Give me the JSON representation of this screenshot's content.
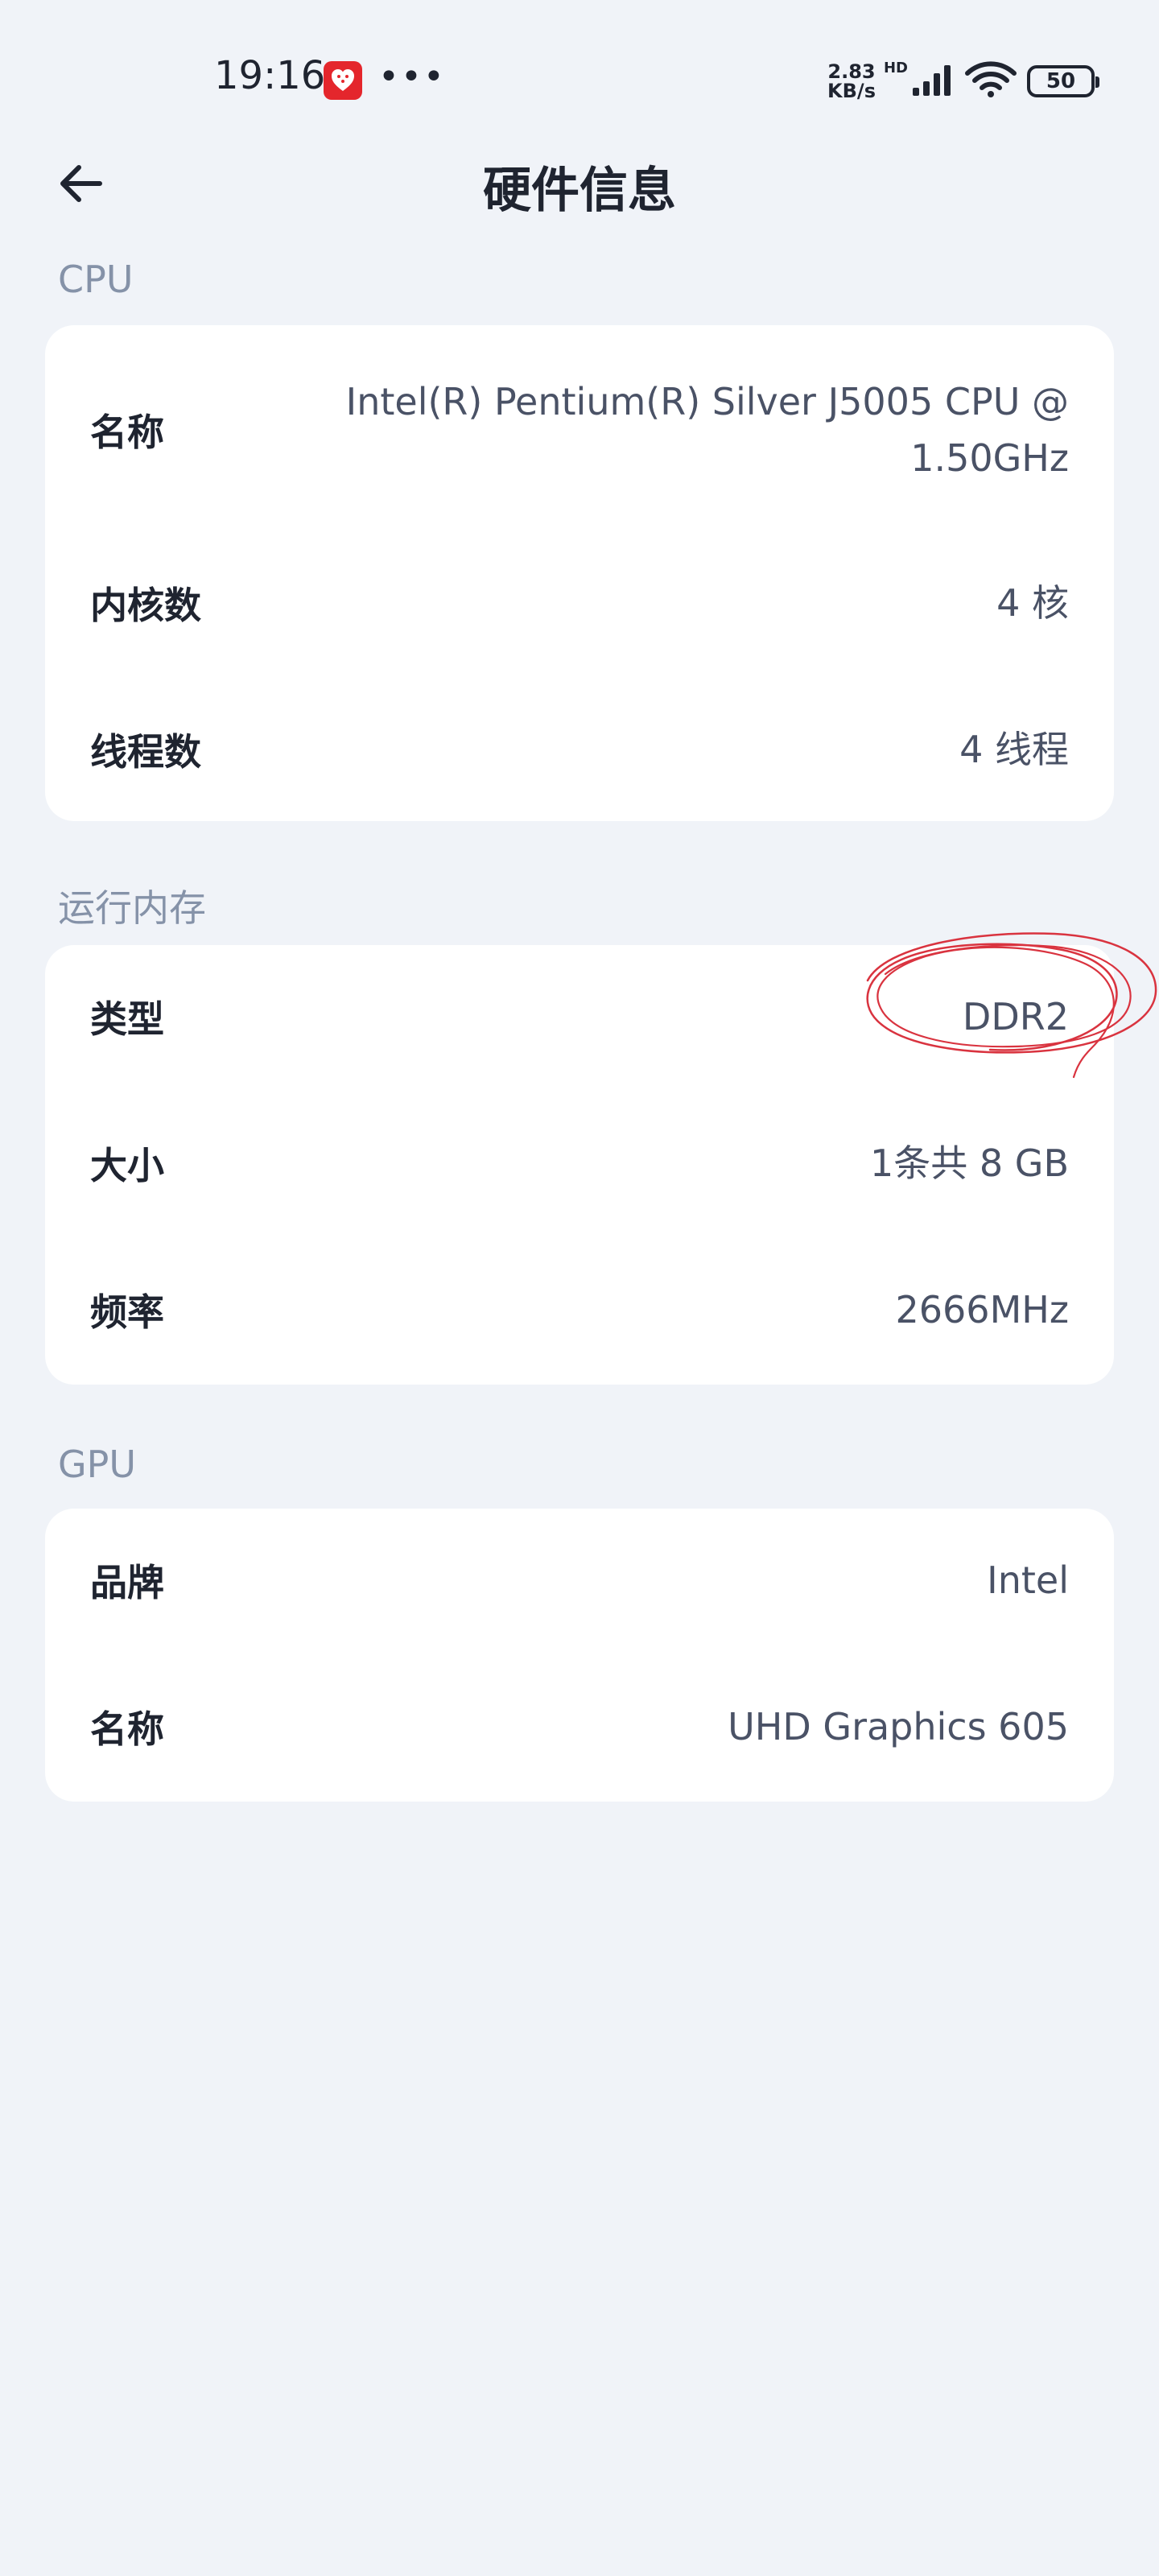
{
  "status_bar": {
    "time": "19:16",
    "speed_value": "2.83",
    "speed_unit": "KB/s",
    "hd_label": "HD",
    "battery": "50",
    "icons": [
      "app-notification-icon",
      "more-dots-icon",
      "signal-icon",
      "wifi-icon",
      "battery-icon"
    ]
  },
  "header": {
    "title": "硬件信息",
    "back_icon": "arrow-left-icon"
  },
  "sections": {
    "cpu": {
      "title": "CPU",
      "rows": [
        {
          "label": "名称",
          "value_line1": "Intel(R) Pentium(R) Silver J5005 CPU @",
          "value_line2": "1.50GHz"
        },
        {
          "label": "内核数",
          "value": "4 核"
        },
        {
          "label": "线程数",
          "value": "4 线程"
        }
      ]
    },
    "memory": {
      "title": "运行内存",
      "rows": [
        {
          "label": "类型",
          "value": "DDR2"
        },
        {
          "label": "大小",
          "value": "1条共 8 GB"
        },
        {
          "label": "频率",
          "value": "2666MHz"
        }
      ]
    },
    "gpu": {
      "title": "GPU",
      "rows": [
        {
          "label": "品牌",
          "value": "Intel"
        },
        {
          "label": "名称",
          "value": "UHD Graphics 605"
        }
      ]
    }
  },
  "colors": {
    "background": "#f0f3f8",
    "card": "#ffffff",
    "section_title": "#8592a8",
    "label": "#1f2430",
    "value": "#4a5266",
    "annotation": "#d9333f"
  }
}
